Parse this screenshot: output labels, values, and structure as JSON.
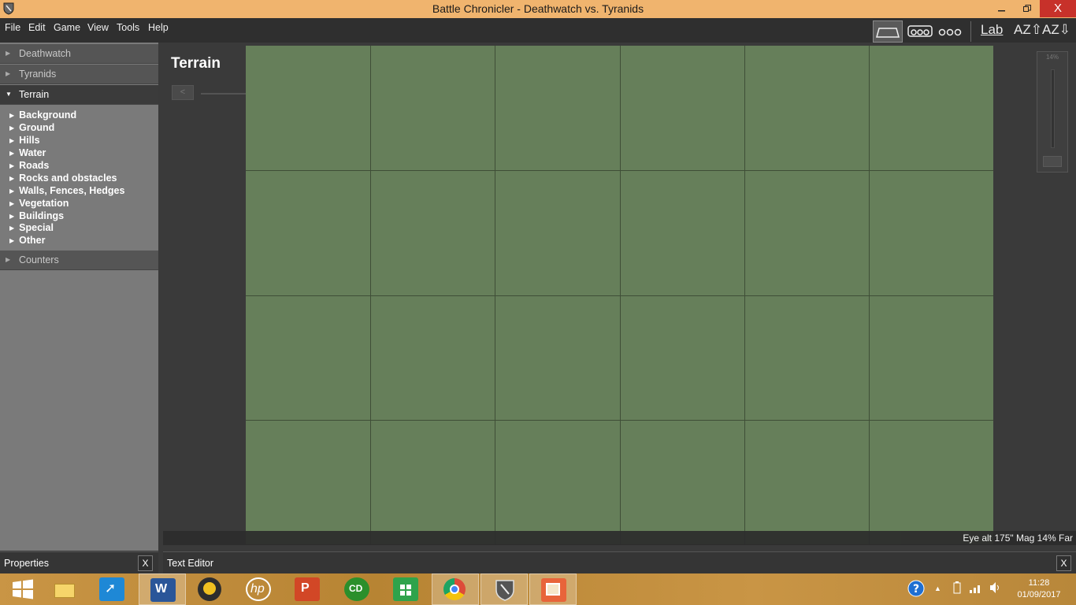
{
  "window": {
    "title": "Battle Chronicler - Deathwatch vs. Tyranids",
    "minimize_icon": "minimize-icon",
    "maximize_icon": "restore-icon",
    "close_label": "X"
  },
  "menu": {
    "items": [
      "File",
      "Edit",
      "Game",
      "View",
      "Tools",
      "Help"
    ]
  },
  "toolbar": {
    "terrain_icon": "terrain-view-icon",
    "units_icon": "units-view-icon",
    "dots_icon": "counters-view-icon",
    "lab_label": "Lab",
    "sort_up_label": "AZ⇧",
    "sort_down_label": "AZ⇩"
  },
  "sidebar": {
    "sections": [
      "Deathwatch",
      "Tyranids",
      "Terrain",
      "Counters"
    ],
    "terrain_items": [
      "Background",
      "Ground",
      "Hills",
      "Water",
      "Roads",
      "Rocks and obstacles",
      "Walls, Fences, Hedges",
      "Vegetation",
      "Buildings",
      "Special",
      "Other"
    ]
  },
  "main": {
    "title": "Terrain",
    "prev_label": "<",
    "next_label": ">",
    "board_color": "#667f5a",
    "grid_cols": 6,
    "grid_rows": 4,
    "zoom_label": "14%",
    "status": "Eye alt 175\"  Mag 14% Far"
  },
  "panels": {
    "properties": "Properties",
    "text_editor": "Text Editor",
    "close_label": "X"
  },
  "taskbar": {
    "apps": [
      {
        "name": "windows-start-icon",
        "color": "#2b8fe3"
      },
      {
        "name": "file-explorer-icon",
        "color": "#e7c14a"
      },
      {
        "name": "rocket-app-icon",
        "color": "#1e88d6"
      },
      {
        "name": "word-icon",
        "color": "#2a5699"
      },
      {
        "name": "media-player-icon",
        "color": "#2d2d2d"
      },
      {
        "name": "hp-icon",
        "color": "#1d1d1d"
      },
      {
        "name": "powerpoint-icon",
        "color": "#d24726"
      },
      {
        "name": "cd-app-icon",
        "color": "#2b8f2b"
      },
      {
        "name": "store-icon",
        "color": "#2fa34b"
      },
      {
        "name": "chrome-icon",
        "color": "#dd4b39"
      },
      {
        "name": "battle-chronicler-icon",
        "color": "#6a6a6a"
      },
      {
        "name": "paint-icon",
        "color": "#e8643a"
      }
    ],
    "time": "11:28",
    "date": "01/09/2017"
  }
}
